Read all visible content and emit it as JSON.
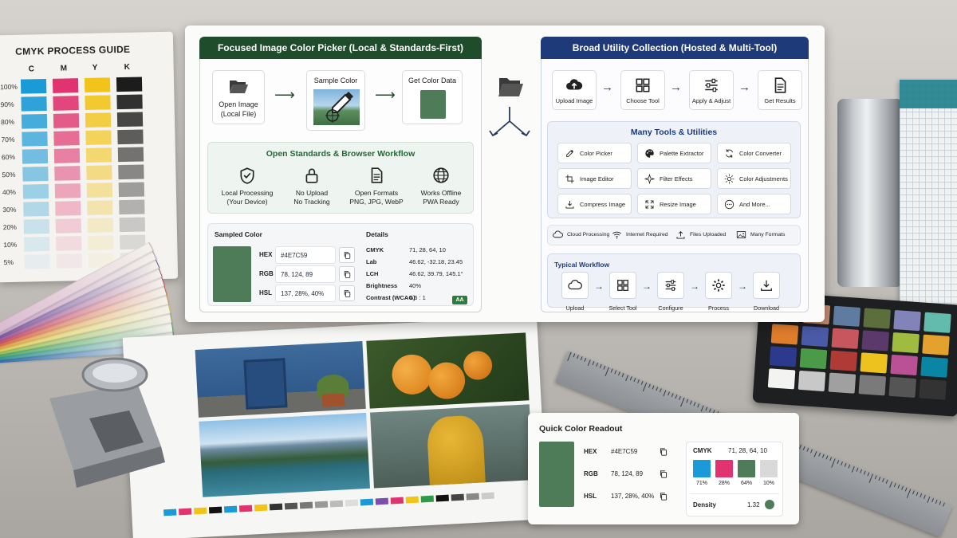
{
  "colors": {
    "green_panel": "#1f4d2b",
    "blue_panel": "#1e3a78",
    "sample": "#4E7C59",
    "cyan": "#1a9ad6",
    "magenta": "#e0336f",
    "yellow": "#f2c419",
    "black": "#1c1c1c",
    "accent_aa": "#2f7a3d"
  },
  "cmyk_guide": {
    "title": "CMYK PROCESS GUIDE",
    "columns": [
      "C",
      "M",
      "Y",
      "K"
    ],
    "percents": [
      "100%",
      "90%",
      "80%",
      "70%",
      "60%",
      "50%",
      "40%",
      "30%",
      "20%",
      "10%",
      "5%"
    ]
  },
  "left_panel": {
    "title": "Focused Image Color Picker (Local & Standards-First)",
    "steps": [
      {
        "icon": "folder-open-icon",
        "label1": "Open Image",
        "label2": "(Local File)"
      },
      {
        "icon": "eyedropper-icon",
        "label1": "Sample Color",
        "label2": ""
      },
      {
        "icon": "color-swatch-icon",
        "label1": "Get Color Data",
        "label2": ""
      }
    ],
    "standards": {
      "title": "Open Standards & Browser Workflow",
      "items": [
        {
          "icon": "shield-check-icon",
          "l1": "Local Processing",
          "l2": "(Your Device)"
        },
        {
          "icon": "lock-icon",
          "l1": "No Upload",
          "l2": "No Tracking"
        },
        {
          "icon": "document-icon",
          "l1": "Open Formats",
          "l2": "PNG, JPG, WebP"
        },
        {
          "icon": "globe-icon",
          "l1": "Works Offline",
          "l2": "PWA Ready"
        }
      ]
    },
    "sampled": {
      "title": "Sampled Color",
      "rows": [
        {
          "k": "HEX",
          "v": "#4E7C59"
        },
        {
          "k": "RGB",
          "v": "78, 124, 89"
        },
        {
          "k": "HSL",
          "v": "137, 28%, 40%"
        }
      ]
    },
    "details": {
      "title": "Details",
      "rows": [
        {
          "k": "CMYK",
          "v": "71, 28, 64, 10"
        },
        {
          "k": "Lab",
          "v": "46.62, -32.18, 23.45"
        },
        {
          "k": "LCH",
          "v": "46.62, 39.79, 145.1°"
        },
        {
          "k": "Brightness",
          "v": "40%"
        },
        {
          "k": "Contrast (WCAG)",
          "v": "4.6 : 1"
        }
      ],
      "badge": "AA"
    }
  },
  "right_panel": {
    "title": "Broad Utility Collection (Hosted & Multi-Tool)",
    "steps": [
      {
        "icon": "cloud-upload-icon",
        "label": "Upload Image"
      },
      {
        "icon": "grid-icon",
        "label": "Choose Tool"
      },
      {
        "icon": "sliders-icon",
        "label": "Apply & Adjust"
      },
      {
        "icon": "document-icon",
        "label": "Get Results"
      }
    ],
    "tools_title": "Many Tools & Utilities",
    "tools": [
      {
        "icon": "eyedropper-icon",
        "label": "Color Picker"
      },
      {
        "icon": "palette-icon",
        "label": "Palette Extractor"
      },
      {
        "icon": "refresh-icon",
        "label": "Color Converter"
      },
      {
        "icon": "crop-icon",
        "label": "Image Editor"
      },
      {
        "icon": "sparkle-icon",
        "label": "Filter Effects"
      },
      {
        "icon": "sun-icon",
        "label": "Color Adjustments"
      },
      {
        "icon": "download-icon",
        "label": "Compress Image"
      },
      {
        "icon": "expand-icon",
        "label": "Resize Image"
      },
      {
        "icon": "more-icon",
        "label": "And More..."
      }
    ],
    "features": [
      {
        "icon": "cloud-icon",
        "label": "Cloud Processing"
      },
      {
        "icon": "wifi-icon",
        "label": "Internet Required"
      },
      {
        "icon": "upload-icon",
        "label": "Files Uploaded"
      },
      {
        "icon": "image-icon",
        "label": "Many Formats"
      }
    ],
    "workflow_title": "Typical Workflow",
    "workflow": [
      {
        "icon": "cloud-icon",
        "label": "Upload"
      },
      {
        "icon": "grid-icon",
        "label": "Select Tool"
      },
      {
        "icon": "sliders-icon",
        "label": "Configure"
      },
      {
        "icon": "gear-icon",
        "label": "Process"
      },
      {
        "icon": "download-icon",
        "label": "Download"
      }
    ]
  },
  "readout": {
    "title": "Quick Color Readout",
    "rows": [
      {
        "k": "HEX",
        "v": "#4E7C59"
      },
      {
        "k": "RGB",
        "v": "78, 124, 89"
      },
      {
        "k": "HSL",
        "v": "137, 28%, 40%"
      }
    ],
    "cmyk_label": "CMYK",
    "cmyk_value": "71, 28, 64, 10",
    "cmyk_pcts": [
      "71%",
      "28%",
      "64%",
      "10%"
    ],
    "density_label": "Density",
    "density_value": "1.32"
  }
}
